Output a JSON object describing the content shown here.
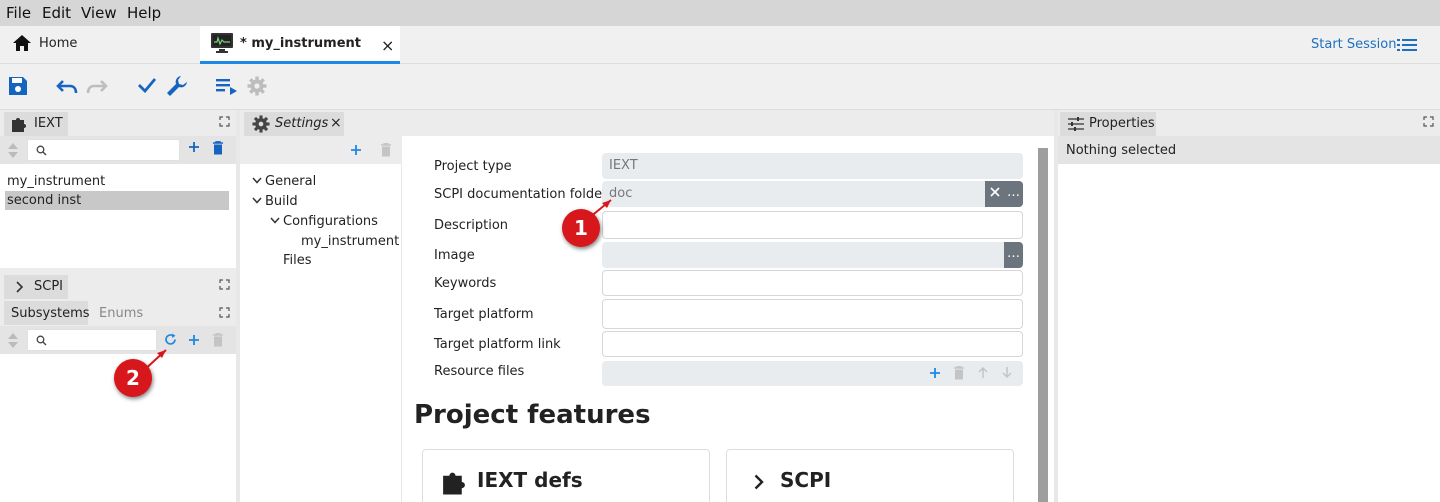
{
  "menubar": {
    "items": [
      "File",
      "Edit",
      "View",
      "Help"
    ]
  },
  "tabs": {
    "home_label": "Home",
    "instrument_label": "* my_instrument",
    "close_icon": "×"
  },
  "header": {
    "start_session": "Start Session"
  },
  "iext_panel": {
    "title": "IEXT",
    "search_placeholder": "",
    "items": [
      "my_instrument",
      "second inst"
    ],
    "selected_index": 1
  },
  "scpi_panel": {
    "title": "SCPI",
    "tabs": [
      "Subsystems",
      "Enums"
    ],
    "search_placeholder": ""
  },
  "settings_panel": {
    "title": "Settings",
    "tree": {
      "general": "General",
      "build": "Build",
      "configurations": "Configurations",
      "config_item": "my_instrument",
      "files": "Files"
    },
    "form": {
      "project_type_label": "Project type",
      "project_type_value": "IEXT",
      "scpi_doc_label": "SCPI documentation folder",
      "scpi_doc_value": "doc",
      "description_label": "Description",
      "image_label": "Image",
      "keywords_label": "Keywords",
      "target_platform_label": "Target platform",
      "target_platform_link_label": "Target platform link",
      "resource_files_label": "Resource files",
      "ellipsis": "…"
    },
    "features_heading": "Project features",
    "feature_cards": [
      "IEXT defs",
      "SCPI"
    ]
  },
  "properties_panel": {
    "title": "Properties",
    "empty_text": "Nothing selected"
  },
  "annotations": {
    "badge1": "1",
    "badge2": "2"
  },
  "colors": {
    "accent": "#1e88e5",
    "badge": "#d7171c",
    "toolbar_blue": "#1565c0"
  }
}
